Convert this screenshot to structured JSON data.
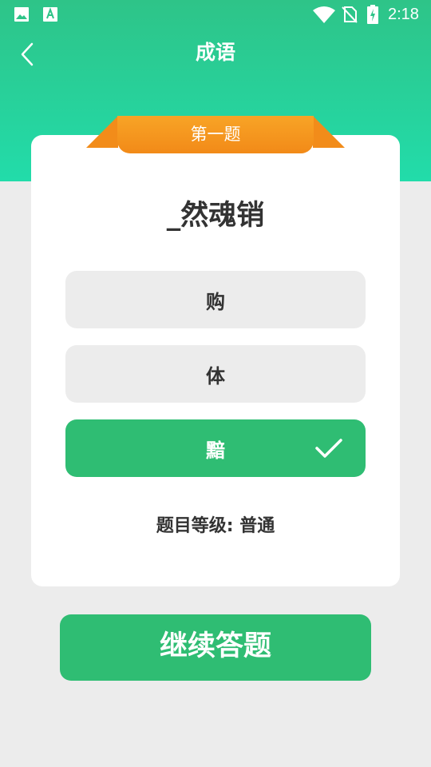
{
  "status_bar": {
    "time": "2:18",
    "icons": [
      "image-icon",
      "a-icon",
      "wifi-icon",
      "no-sim-icon",
      "battery-charging-icon"
    ]
  },
  "header": {
    "title": "成语",
    "back_icon": "chevron-left-icon"
  },
  "quiz": {
    "badge": "第一题",
    "question": "_然魂销",
    "options": [
      {
        "label": "购",
        "state": "default"
      },
      {
        "label": "体",
        "state": "default"
      },
      {
        "label": "黯",
        "state": "correct"
      }
    ],
    "level_text": "题目等级: 普通"
  },
  "actions": {
    "continue_label": "继续答题"
  },
  "colors": {
    "header_top": "#2ec488",
    "header_bottom": "#22dcaa",
    "ribbon": "#f28a18",
    "correct": "#2fbd73",
    "option_bg": "#ececec",
    "page_bg": "#ececec"
  }
}
